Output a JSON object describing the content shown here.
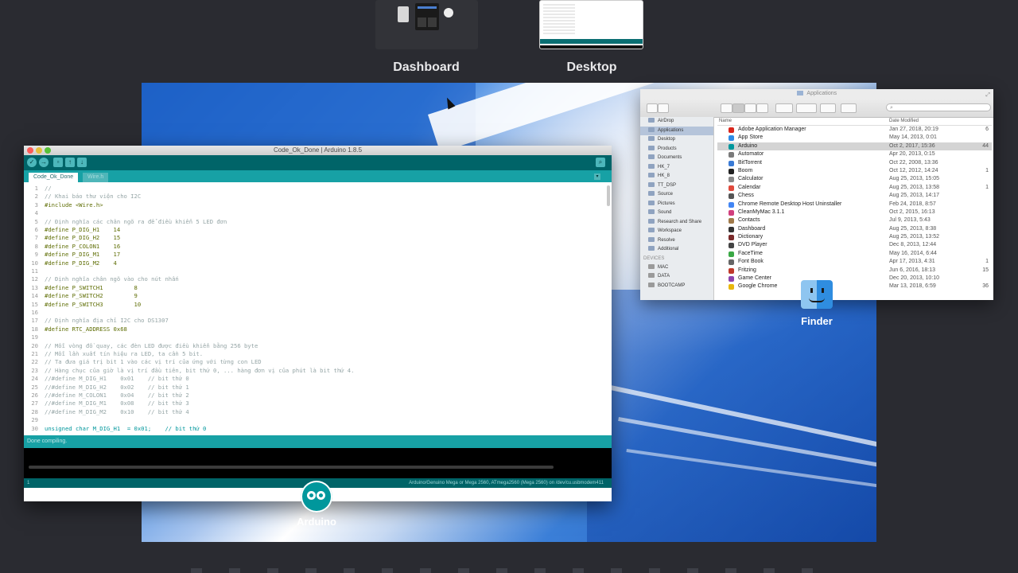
{
  "spaces": [
    {
      "label": "Dashboard"
    },
    {
      "label": "Desktop"
    }
  ],
  "arduino": {
    "window_title": "Code_Ok_Done | Arduino 1.8.5",
    "tabs": [
      "Code_Ok_Done",
      "Wire.h"
    ],
    "code": [
      {
        "n": "1",
        "t": "//",
        "c": "cm"
      },
      {
        "n": "2",
        "t": "// Khai báo thư viện cho I2C",
        "c": "cm"
      },
      {
        "n": "3",
        "t": "#include <Wire.h>",
        "c": "kw"
      },
      {
        "n": "4",
        "t": "",
        "c": "tx"
      },
      {
        "n": "5",
        "t": "// Định nghĩa các chân ngõ ra để điều khiển 5 LED đơn",
        "c": "cm"
      },
      {
        "n": "6",
        "t": "#define P_DIG_H1    14",
        "c": "kw"
      },
      {
        "n": "7",
        "t": "#define P_DIG_H2    15",
        "c": "kw"
      },
      {
        "n": "8",
        "t": "#define P_COLON1    16",
        "c": "kw"
      },
      {
        "n": "9",
        "t": "#define P_DIG_M1    17",
        "c": "kw"
      },
      {
        "n": "10",
        "t": "#define P_DIG_M2    4",
        "c": "kw"
      },
      {
        "n": "11",
        "t": "",
        "c": "tx"
      },
      {
        "n": "12",
        "t": "// Định nghĩa chân ngõ vào cho nút nhấn",
        "c": "cm"
      },
      {
        "n": "13",
        "t": "#define P_SWITCH1         8",
        "c": "kw"
      },
      {
        "n": "14",
        "t": "#define P_SWITCH2         9",
        "c": "kw"
      },
      {
        "n": "15",
        "t": "#define P_SWITCH3         10",
        "c": "kw"
      },
      {
        "n": "16",
        "t": "",
        "c": "tx"
      },
      {
        "n": "17",
        "t": "// Định nghĩa địa chỉ I2C cho DS1307",
        "c": "cm"
      },
      {
        "n": "18",
        "t": "#define RTC_ADDRESS 0x68",
        "c": "kw"
      },
      {
        "n": "19",
        "t": "",
        "c": "tx"
      },
      {
        "n": "20",
        "t": "// Mỗi vòng đồ quay, các đèn LED được điều khiển bằng 256 byte",
        "c": "cm"
      },
      {
        "n": "21",
        "t": "// Mỗi lần xuất tín hiệu ra LED, ta cần 5 bit.",
        "c": "cm"
      },
      {
        "n": "22",
        "t": "// Ta đưa giá trị bit 1 vào các vị trí của ứng với từng con LED",
        "c": "cm"
      },
      {
        "n": "23",
        "t": "// Hàng chục của giờ là vị trí đầu tiên, bit thứ 0, ... hàng đơn vị của phút là bit thứ 4.",
        "c": "cm"
      },
      {
        "n": "24",
        "t": "//#define M_DIG_H1    0x01    // bit thứ 0",
        "c": "cm"
      },
      {
        "n": "25",
        "t": "//#define M_DIG_H2    0x02    // bit thứ 1",
        "c": "cm"
      },
      {
        "n": "26",
        "t": "//#define M_COLON1    0x04    // bit thứ 2",
        "c": "cm"
      },
      {
        "n": "27",
        "t": "//#define M_DIG_M1    0x08    // bit thứ 3",
        "c": "cm"
      },
      {
        "n": "28",
        "t": "//#define M_DIG_M2    0x10    // bit thứ 4",
        "c": "cm"
      },
      {
        "n": "29",
        "t": "",
        "c": "tx"
      },
      {
        "n": "30",
        "t": "unsigned char M_DIG_H1  = 0x01;    // bit thứ 0",
        "c": "ty"
      }
    ],
    "status": "Done compiling.",
    "footer_line": "1",
    "board": "Arduino/Genuino Mega or Mega 2560, ATmega2560 (Mega 2560) on /dev/cu.usbmodem411",
    "dock_label": "Arduino"
  },
  "finder": {
    "window_title": "Applications",
    "search_placeholder": "",
    "sidebar": {
      "favorites": [
        "AirDrop",
        "Applications",
        "Desktop",
        "Products",
        "Documents",
        "HK_7",
        "HK_8",
        "TT_DSP",
        "Source",
        "Pictures",
        "Sound",
        "Research and Share",
        "Workspace",
        "Resolve",
        "Additional"
      ],
      "devices_header": "DEVICES",
      "devices": [
        "MAC",
        "DATA",
        "BOOTCAMP"
      ]
    },
    "columns": {
      "name": "Name",
      "date": "Date Modified"
    },
    "rows": [
      {
        "name": "Adobe Application Manager",
        "date": "Jan 27, 2018, 20:19",
        "size": "6",
        "color": "#d9261c"
      },
      {
        "name": "App Store",
        "date": "May 14, 2013, 0:01",
        "size": "",
        "color": "#2f8ce6"
      },
      {
        "name": "Arduino",
        "date": "Oct 2, 2017, 15:36",
        "size": "44",
        "color": "#00979c"
      },
      {
        "name": "Automator",
        "date": "Apr 20, 2013, 0:15",
        "size": "",
        "color": "#7a7a7a"
      },
      {
        "name": "BitTorrent",
        "date": "Oct 22, 2008, 13:36",
        "size": "",
        "color": "#3a7bd5"
      },
      {
        "name": "Boom",
        "date": "Oct 12, 2012, 14:24",
        "size": "1",
        "color": "#222"
      },
      {
        "name": "Calculator",
        "date": "Aug 25, 2013, 15:05",
        "size": "",
        "color": "#888"
      },
      {
        "name": "Calendar",
        "date": "Aug 25, 2013, 13:58",
        "size": "1",
        "color": "#e04a3c"
      },
      {
        "name": "Chess",
        "date": "Aug 25, 2013, 14:17",
        "size": "",
        "color": "#555"
      },
      {
        "name": "Chrome Remote Desktop Host Uninstaller",
        "date": "Feb 24, 2018, 8:57",
        "size": "",
        "color": "#4285f4"
      },
      {
        "name": "CleanMyMac 3.1.1",
        "date": "Oct 2, 2015, 16:13",
        "size": "",
        "color": "#d13f7d"
      },
      {
        "name": "Contacts",
        "date": "Jul 9, 2013, 5:43",
        "size": "",
        "color": "#a07a4a"
      },
      {
        "name": "Dashboard",
        "date": "Aug 25, 2013, 8:38",
        "size": "",
        "color": "#333"
      },
      {
        "name": "Dictionary",
        "date": "Aug 25, 2013, 13:52",
        "size": "",
        "color": "#7a2a2a"
      },
      {
        "name": "DVD Player",
        "date": "Dec 8, 2013, 12:44",
        "size": "",
        "color": "#444"
      },
      {
        "name": "FaceTime",
        "date": "May 16, 2014, 6:44",
        "size": "",
        "color": "#3aa845"
      },
      {
        "name": "Font Book",
        "date": "Apr 17, 2013, 4:31",
        "size": "1",
        "color": "#666"
      },
      {
        "name": "Fritzing",
        "date": "Jun 6, 2016, 18:13",
        "size": "15",
        "color": "#c0392b"
      },
      {
        "name": "Game Center",
        "date": "Dec 20, 2013, 10:10",
        "size": "",
        "color": "#8e44ad"
      },
      {
        "name": "Google Chrome",
        "date": "Mar 13, 2018, 6:59",
        "size": "36",
        "color": "#e8b70d"
      }
    ],
    "dock_label": "Finder"
  }
}
